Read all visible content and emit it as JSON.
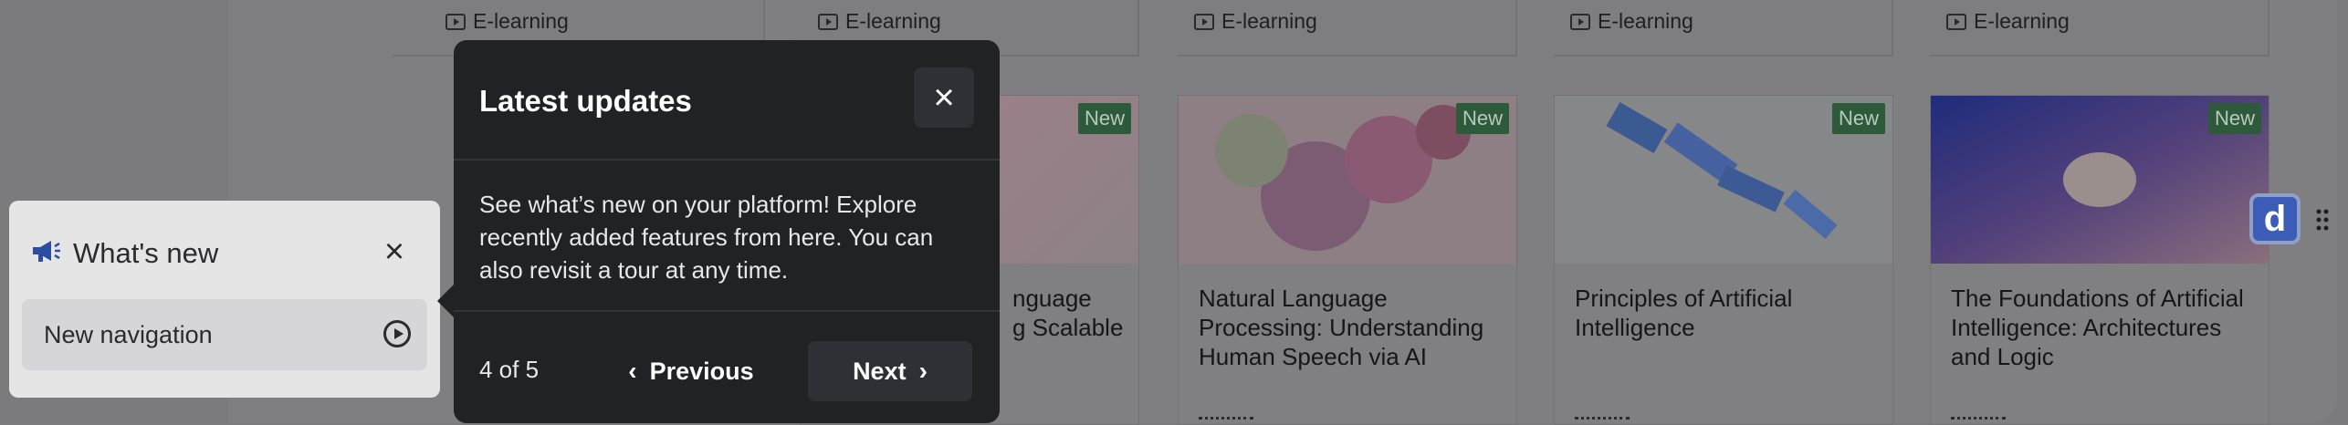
{
  "top_cards": [
    {
      "label": "E-learning"
    },
    {
      "label": "E-learning"
    },
    {
      "label": "E-learning"
    },
    {
      "label": "E-learning"
    },
    {
      "label": "E-learning"
    }
  ],
  "courses": [
    {
      "badge": "New",
      "title": "nguage\ng Scalable"
    },
    {
      "badge": "New",
      "title": "Natural Language Processing: Understanding Human Speech via AI"
    },
    {
      "badge": "New",
      "title": "Principles of Artificial Intelligence"
    },
    {
      "badge": "New",
      "title": "The Foundations of Artificial Intelligence: Architectures and Logic"
    }
  ],
  "whats_new": {
    "title": "What's new",
    "icon": "megaphone-icon",
    "items": [
      {
        "label": "New navigation",
        "icon": "play-circle-icon"
      }
    ]
  },
  "tour": {
    "title": "Latest updates",
    "body": "See what’s new on your platform! Explore recently added features from here. You can also revisit a tour at any time.",
    "step": "4 of 5",
    "previous_label": "Previous",
    "next_label": "Next"
  },
  "side_widget": {
    "letter": "d"
  },
  "colors": {
    "badge": "#2d5a3a",
    "popover": "#212226",
    "widget": "#3c5db7"
  }
}
